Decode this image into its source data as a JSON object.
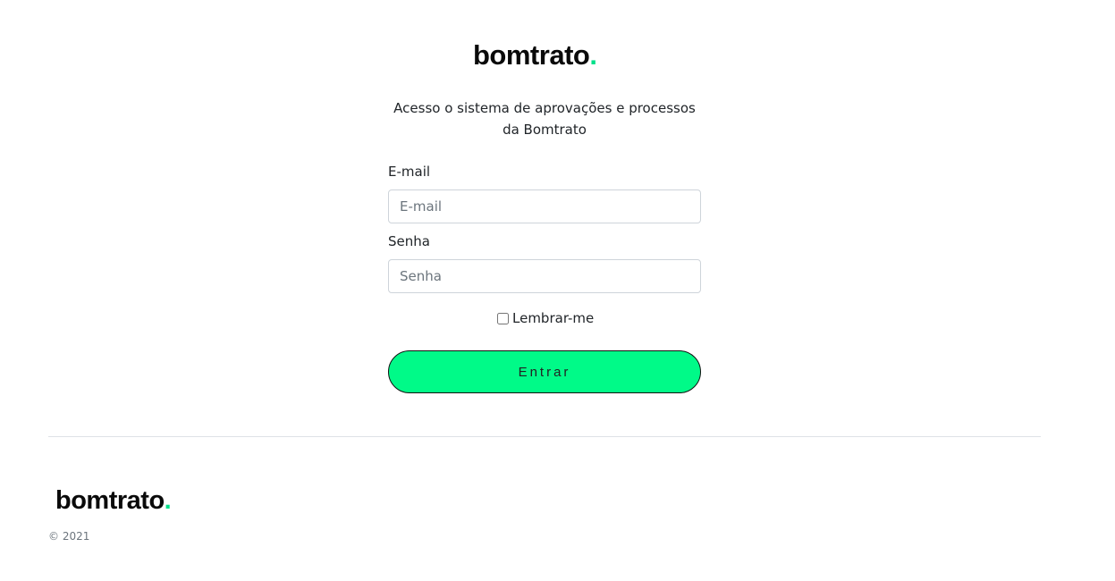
{
  "brand": {
    "name": "bomtrato",
    "dot": ".",
    "accent_color": "#00e08a"
  },
  "login": {
    "subtitle": "Acesso o sistema de aprovações e processos da Bomtrato",
    "email_label": "E-mail",
    "email_placeholder": "E-mail",
    "email_value": "",
    "password_label": "Senha",
    "password_placeholder": "Senha",
    "password_value": "",
    "remember_label": "Lembrar-me",
    "remember_checked": false,
    "submit_label": "Entrar",
    "submit_color": "#00fa88"
  },
  "footer": {
    "copyright": "© 2021"
  }
}
